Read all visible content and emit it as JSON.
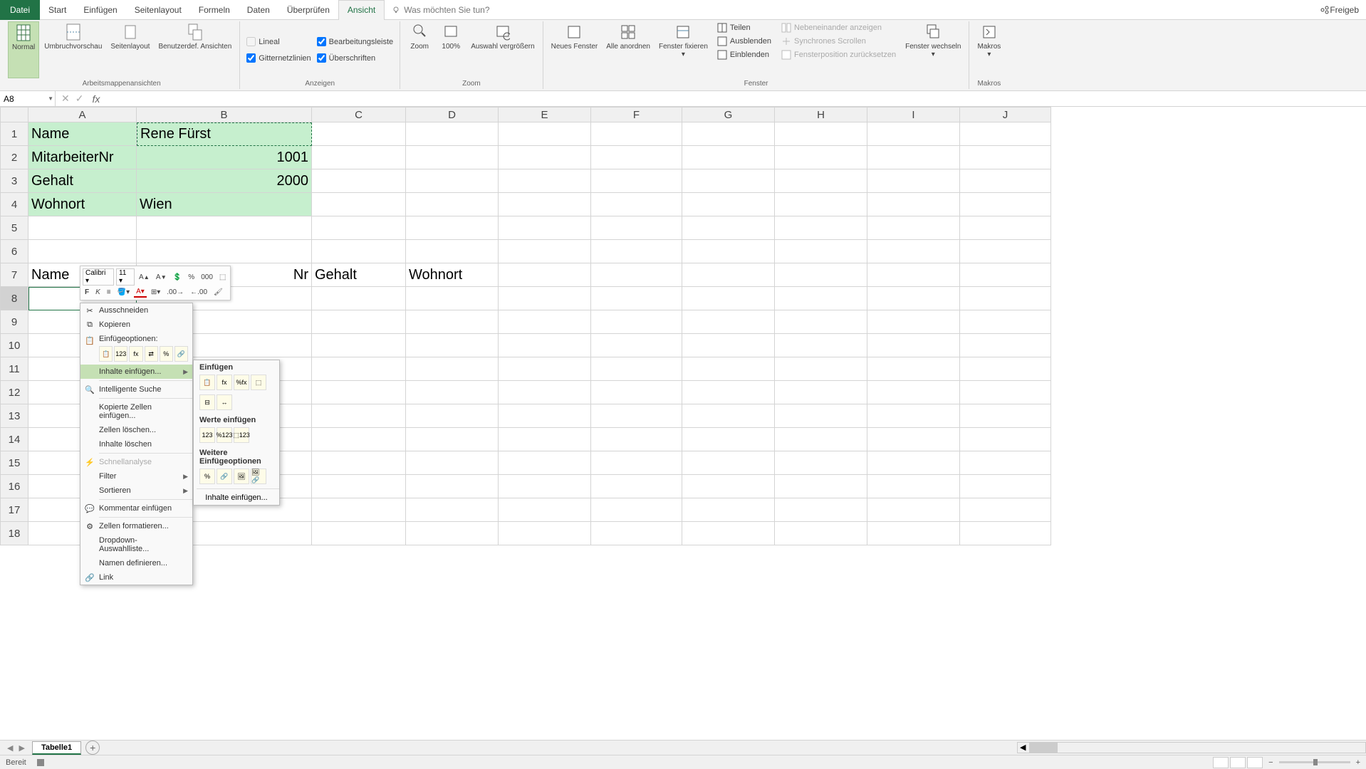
{
  "menu": {
    "file": "Datei",
    "tabs": [
      "Start",
      "Einfügen",
      "Seitenlayout",
      "Formeln",
      "Daten",
      "Überprüfen",
      "Ansicht"
    ],
    "active_tab": "Ansicht",
    "search_hint": "Was möchten Sie tun?",
    "share": "Freigeb"
  },
  "ribbon": {
    "views": {
      "normal": "Normal",
      "pagebreak": "Umbruchvorschau",
      "layout": "Seitenlayout",
      "custom": "Benutzerdef. Ansichten",
      "group": "Arbeitsmappenansichten"
    },
    "show": {
      "ruler": "Lineal",
      "formula": "Bearbeitungsleiste",
      "gridlines": "Gitternetzlinien",
      "headings": "Überschriften",
      "group": "Anzeigen"
    },
    "zoom": {
      "zoom": "Zoom",
      "hundred": "100%",
      "selection": "Auswahl vergrößern",
      "group": "Zoom"
    },
    "window": {
      "new": "Neues Fenster",
      "arrange": "Alle anordnen",
      "freeze": "Fenster fixieren",
      "split": "Teilen",
      "hide": "Ausblenden",
      "unhide": "Einblenden",
      "side": "Nebeneinander anzeigen",
      "sync": "Synchrones Scrollen",
      "reset": "Fensterposition zurücksetzen",
      "switch": "Fenster wechseln",
      "group": "Fenster"
    },
    "macros": {
      "macros": "Makros",
      "group": "Makros"
    }
  },
  "namebox": "A8",
  "columns": [
    "A",
    "B",
    "C",
    "D",
    "E",
    "F",
    "G",
    "H",
    "I",
    "J"
  ],
  "rows": [
    "1",
    "2",
    "3",
    "4",
    "5",
    "6",
    "7",
    "8",
    "9",
    "10",
    "11",
    "12",
    "13",
    "14",
    "15",
    "16",
    "17",
    "18"
  ],
  "cells": {
    "A1": "Name",
    "B1": "Rene Fürst",
    "A2": "MitarbeiterNr",
    "B2": "1001",
    "A3": "Gehalt",
    "B3": "2000",
    "A4": "Wohnort",
    "B4": "Wien",
    "A7": "Name",
    "B7_partial": "Nr",
    "C7": "Gehalt",
    "D7": "Wohnort"
  },
  "mini_toolbar": {
    "font": "Calibri",
    "size": "11"
  },
  "context_menu": {
    "cut": "Ausschneiden",
    "copy": "Kopieren",
    "paste_options": "Einfügeoptionen:",
    "paste_special": "Inhalte einfügen...",
    "smart_lookup": "Intelligente Suche",
    "insert_copied": "Kopierte Zellen einfügen...",
    "delete": "Zellen löschen...",
    "clear": "Inhalte löschen",
    "quick": "Schnellanalyse",
    "filter": "Filter",
    "sort": "Sortieren",
    "comment": "Kommentar einfügen",
    "format": "Zellen formatieren...",
    "dropdown": "Dropdown-Auswahlliste...",
    "name": "Namen definieren...",
    "link": "Link"
  },
  "paste_submenu": {
    "paste": "Einfügen",
    "values": "Werte einfügen",
    "other": "Weitere Einfügeoptionen",
    "special": "Inhalte einfügen..."
  },
  "sheet_tab": "Tabelle1",
  "status": "Bereit"
}
